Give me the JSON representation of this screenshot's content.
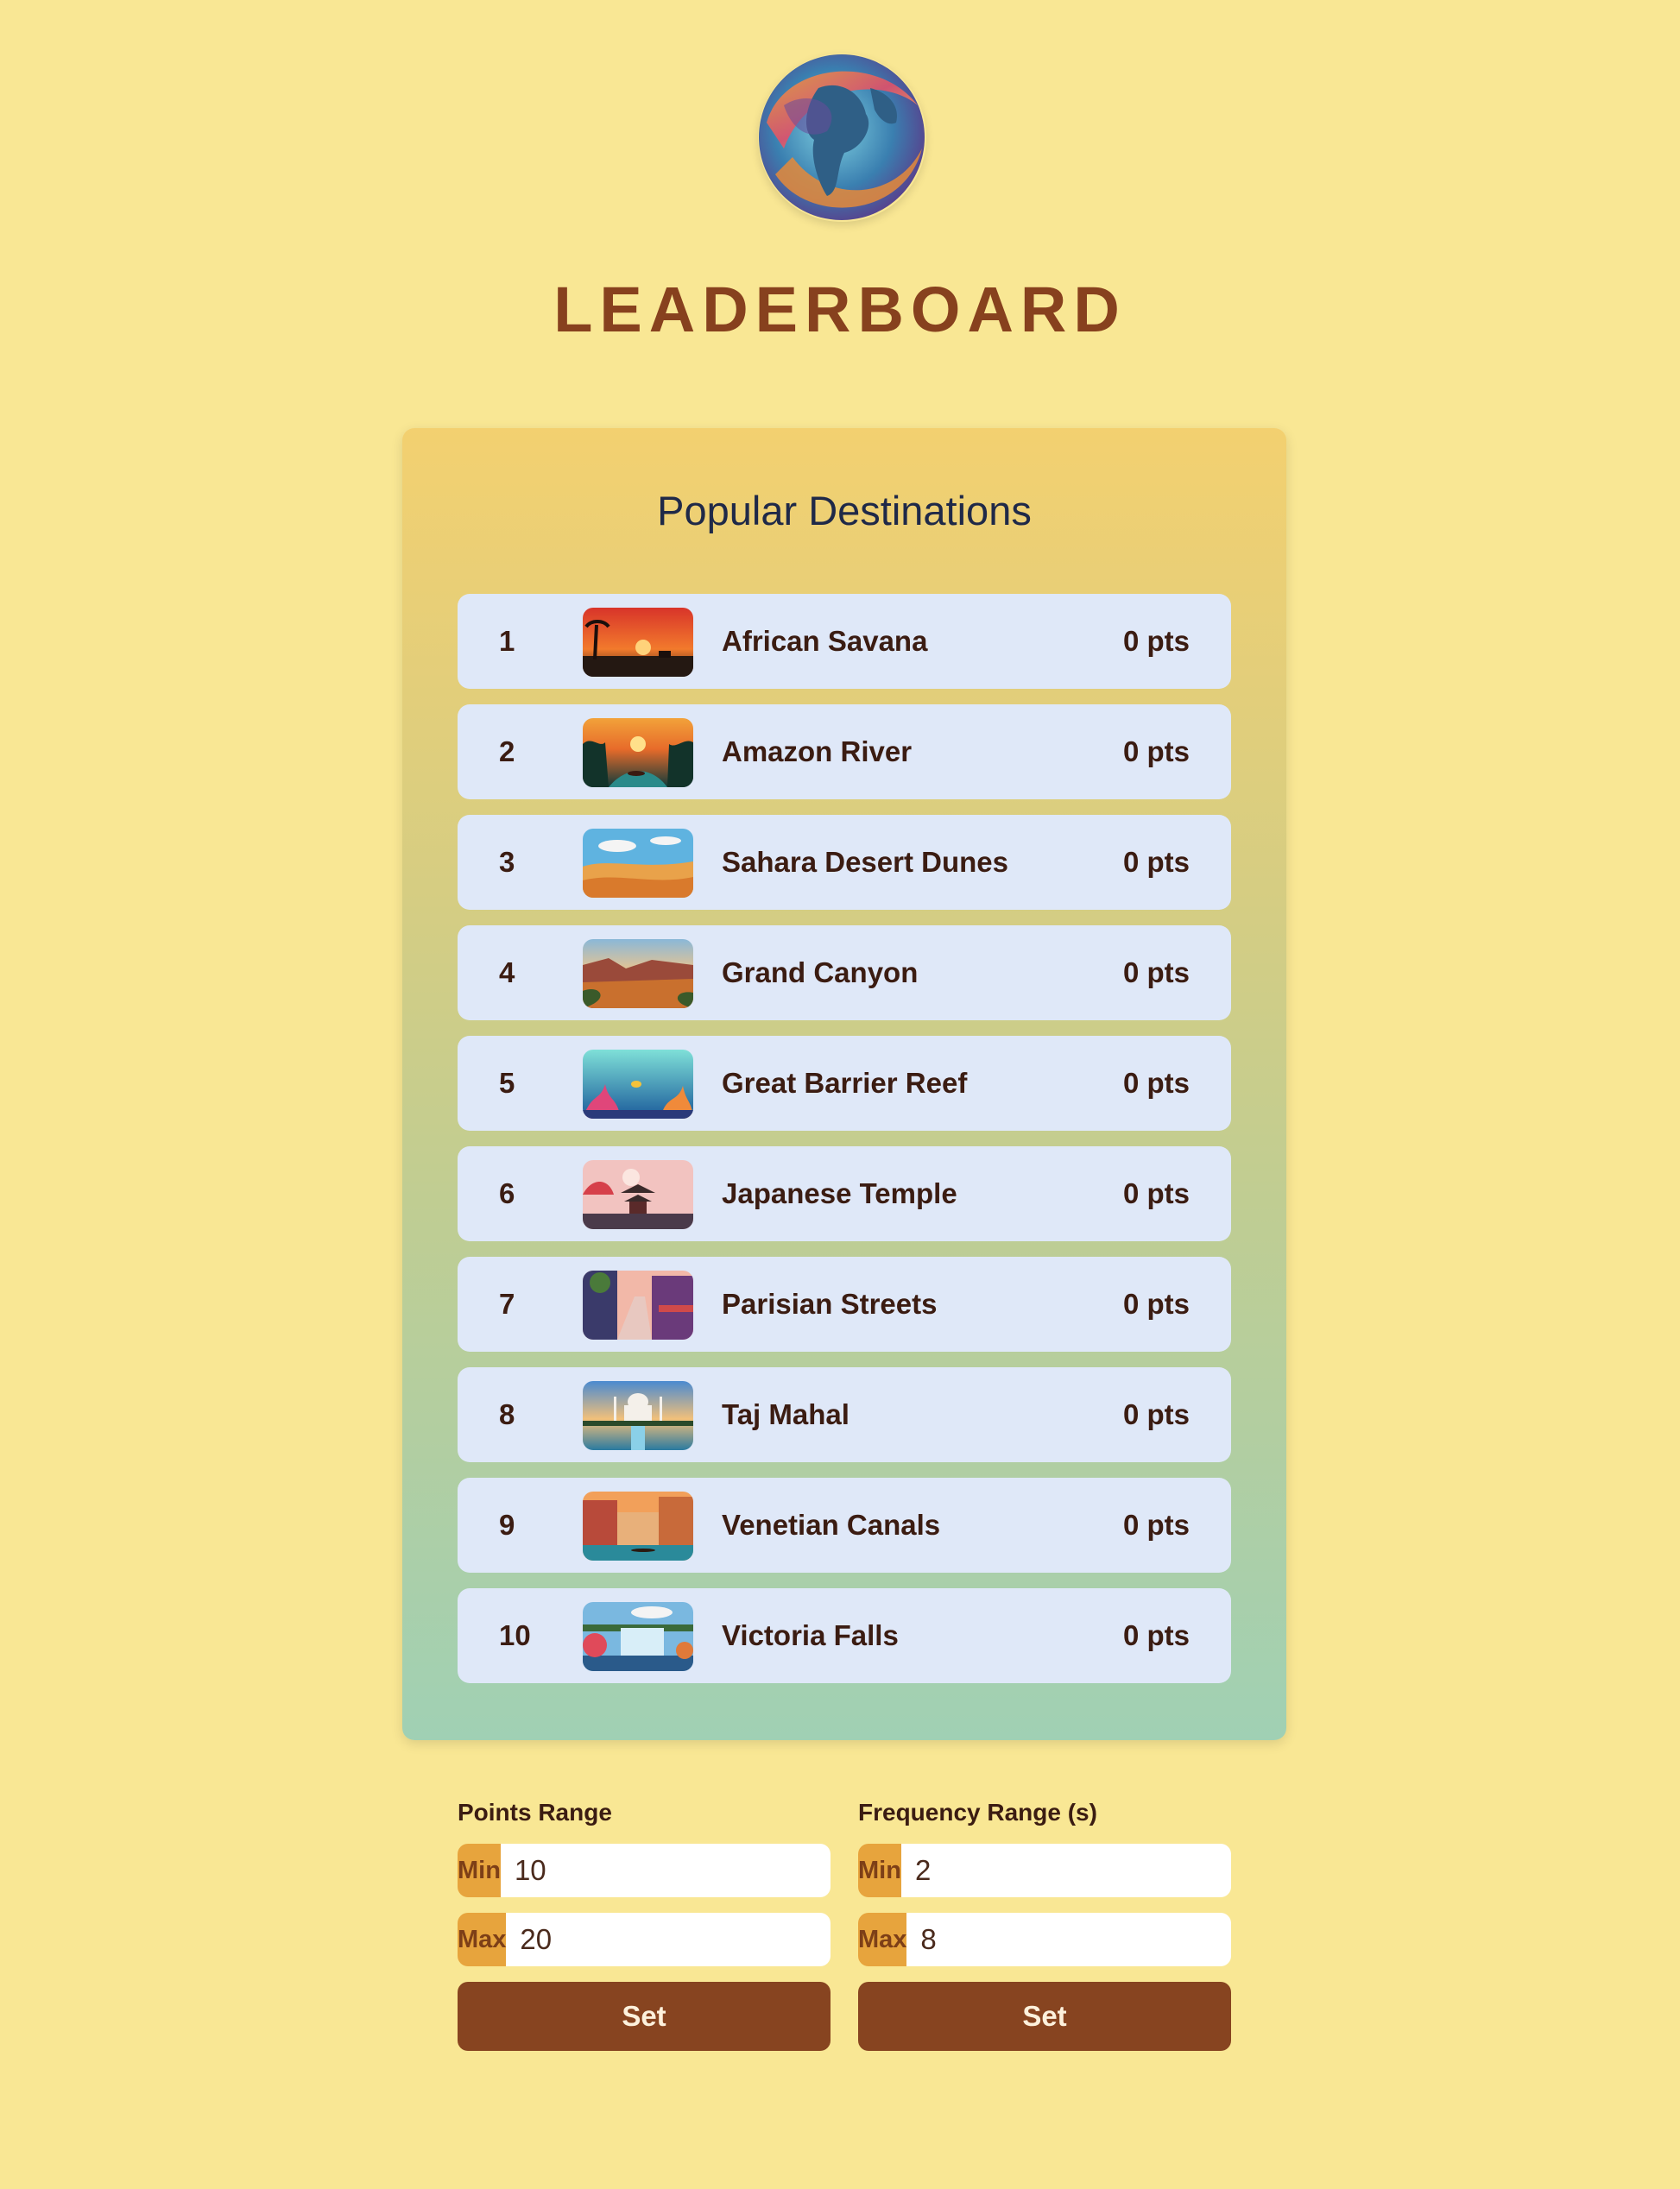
{
  "header": {
    "logo_icon": "globe-logo-icon",
    "title": "LEADERBOARD"
  },
  "leaderboard": {
    "title": "Popular Destinations",
    "entries": [
      {
        "rank": "1",
        "name": "African Savana",
        "score": "0 pts",
        "thumb": "savanna-sunset-thumbnail"
      },
      {
        "rank": "2",
        "name": "Amazon River",
        "score": "0 pts",
        "thumb": "amazon-river-thumbnail"
      },
      {
        "rank": "3",
        "name": "Sahara Desert Dunes",
        "score": "0 pts",
        "thumb": "desert-dunes-thumbnail"
      },
      {
        "rank": "4",
        "name": "Grand Canyon",
        "score": "0 pts",
        "thumb": "grand-canyon-thumbnail"
      },
      {
        "rank": "5",
        "name": "Great Barrier Reef",
        "score": "0 pts",
        "thumb": "coral-reef-thumbnail"
      },
      {
        "rank": "6",
        "name": "Japanese Temple",
        "score": "0 pts",
        "thumb": "japanese-temple-thumbnail"
      },
      {
        "rank": "7",
        "name": "Parisian Streets",
        "score": "0 pts",
        "thumb": "paris-street-thumbnail"
      },
      {
        "rank": "8",
        "name": "Taj Mahal",
        "score": "0 pts",
        "thumb": "taj-mahal-thumbnail"
      },
      {
        "rank": "9",
        "name": "Venetian Canals",
        "score": "0 pts",
        "thumb": "venice-canal-thumbnail"
      },
      {
        "rank": "10",
        "name": "Victoria Falls",
        "score": "0 pts",
        "thumb": "waterfall-thumbnail"
      }
    ]
  },
  "points_range": {
    "label": "Points Range",
    "min_label": "Min",
    "min_value": "10",
    "max_label": "Max",
    "max_value": "20",
    "button": "Set"
  },
  "frequency_range": {
    "label": "Frequency Range (s)",
    "min_label": "Min",
    "min_value": "2",
    "max_label": "Max",
    "max_value": "8",
    "button": "Set"
  },
  "colors": {
    "background": "#f9e794",
    "title": "#87411e",
    "row_background": "#dfe8f8",
    "input_prefix": "#e7a43d",
    "button": "#874420"
  }
}
